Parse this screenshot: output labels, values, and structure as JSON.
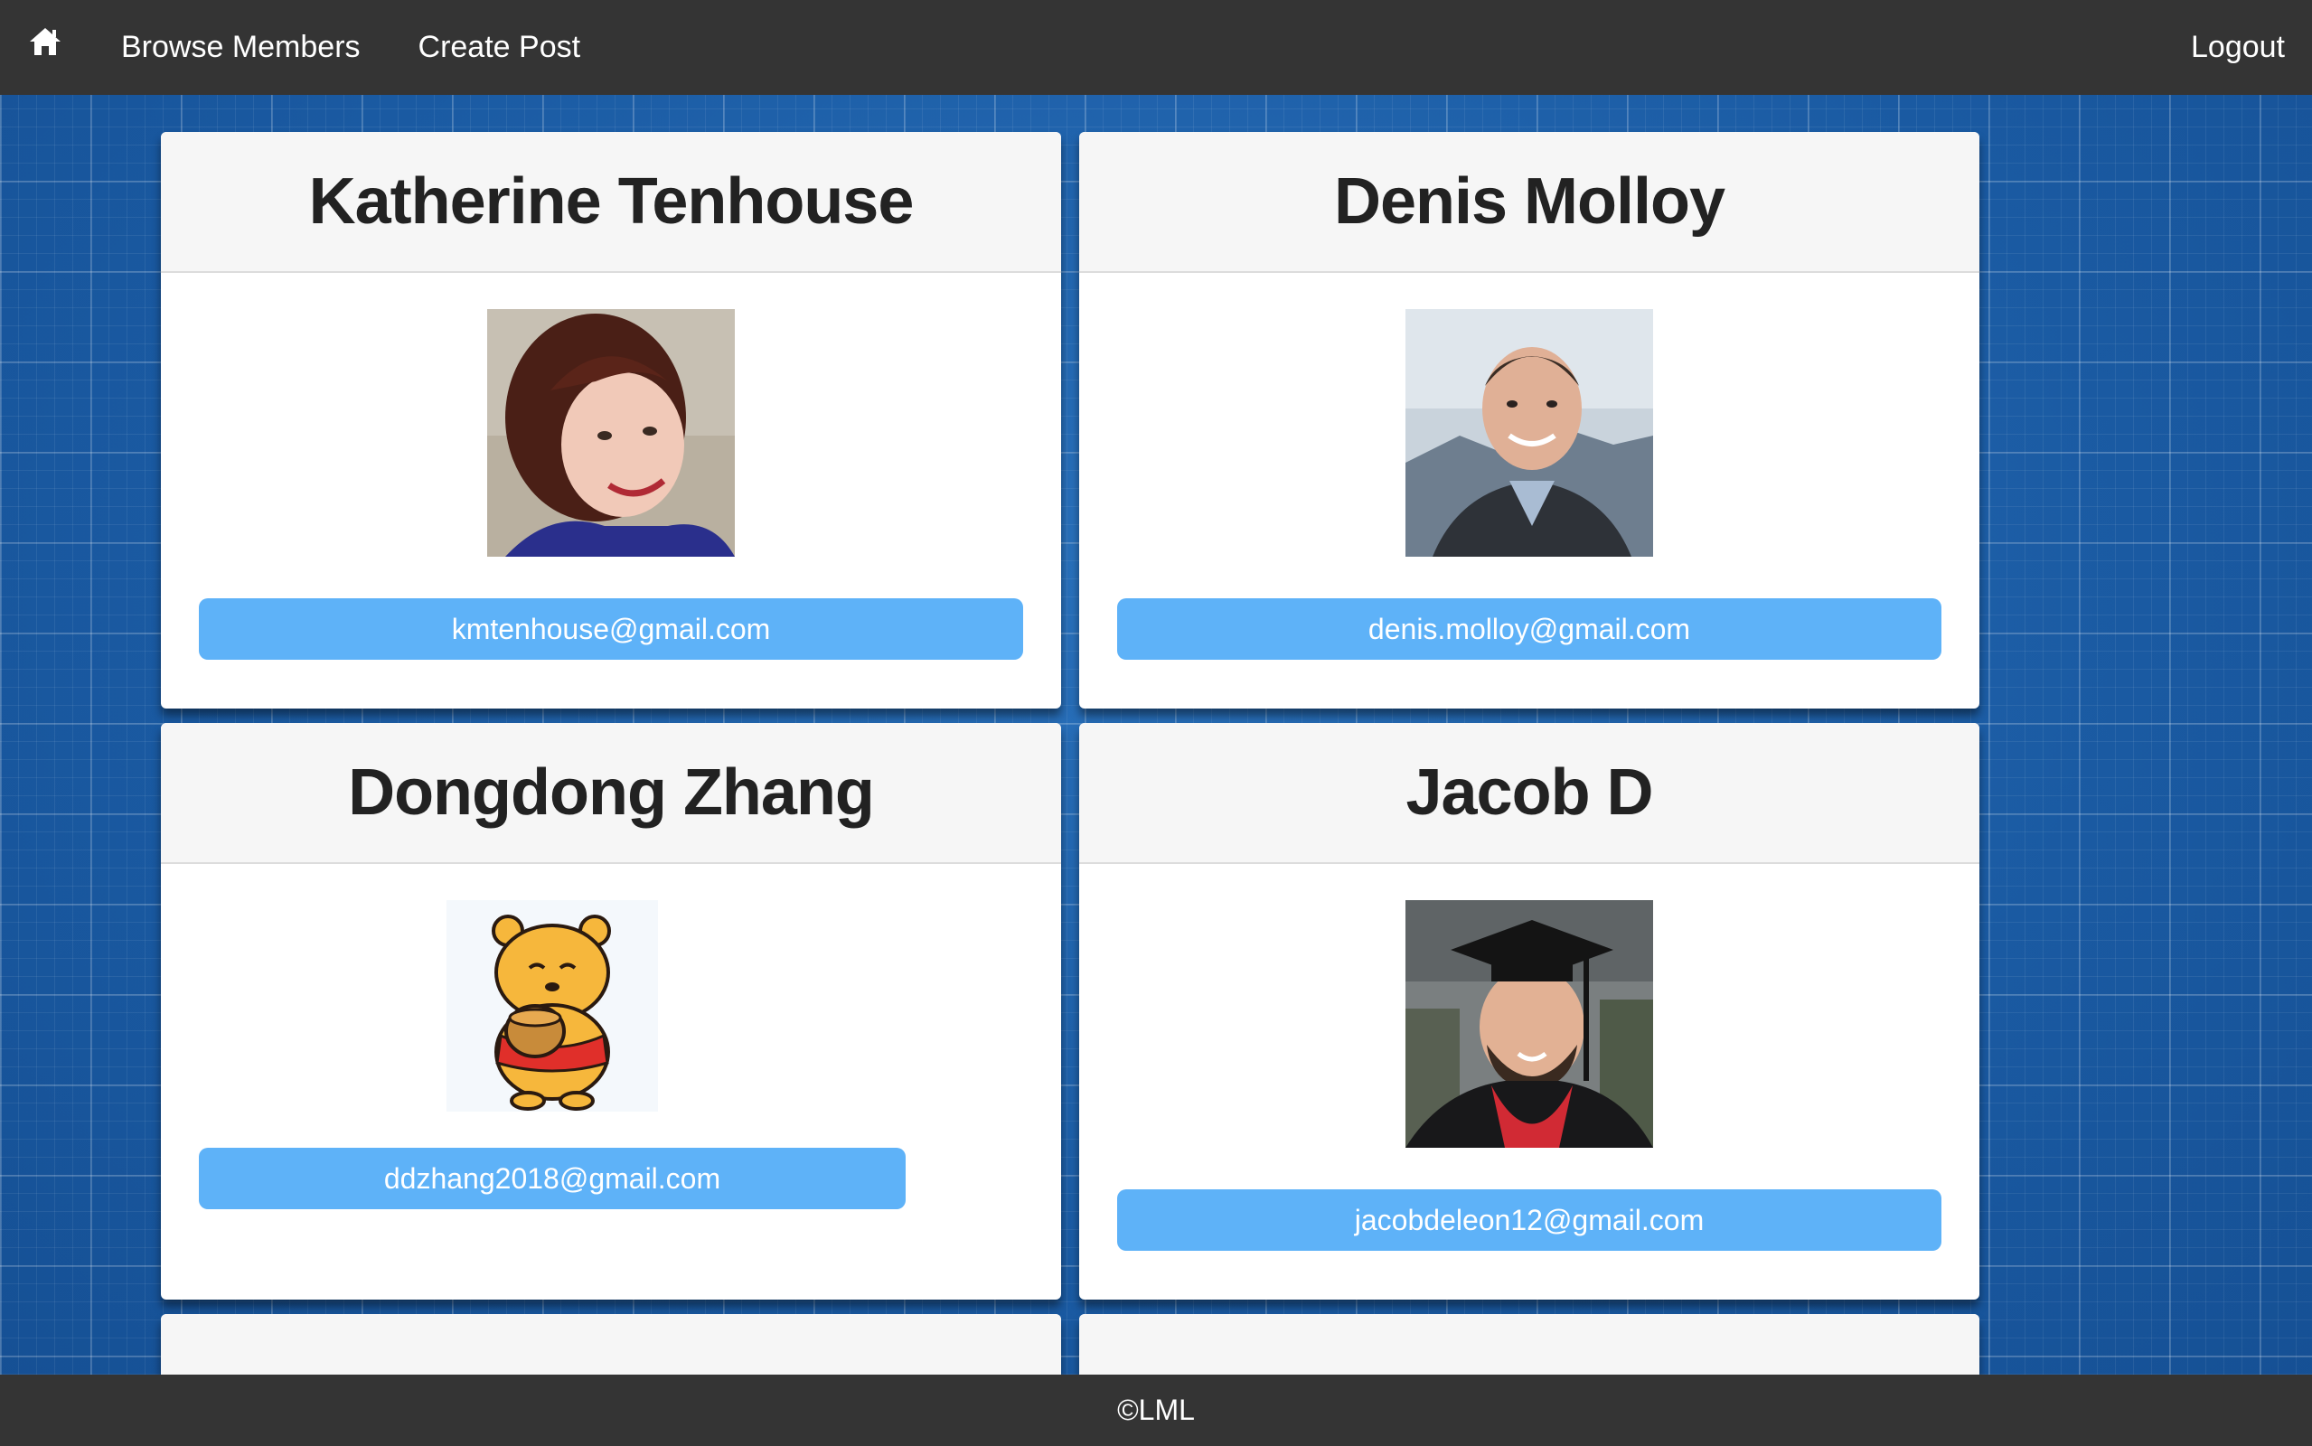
{
  "nav": {
    "home_icon": "home-icon",
    "browse_members": "Browse Members",
    "create_post": "Create Post",
    "logout": "Logout"
  },
  "members": [
    {
      "name": "Katherine Tenhouse",
      "email": "kmtenhouse@gmail.com"
    },
    {
      "name": "Denis Molloy",
      "email": "denis.molloy@gmail.com"
    },
    {
      "name": "Dongdong Zhang",
      "email": "ddzhang2018@gmail.com"
    },
    {
      "name": "Jacob D",
      "email": "jacobdeleon12@gmail.com"
    }
  ],
  "footer": {
    "text": "©LML"
  },
  "colors": {
    "navbar": "#343434",
    "email_button": "#5eb2f8",
    "background": "#1b5fa8"
  }
}
